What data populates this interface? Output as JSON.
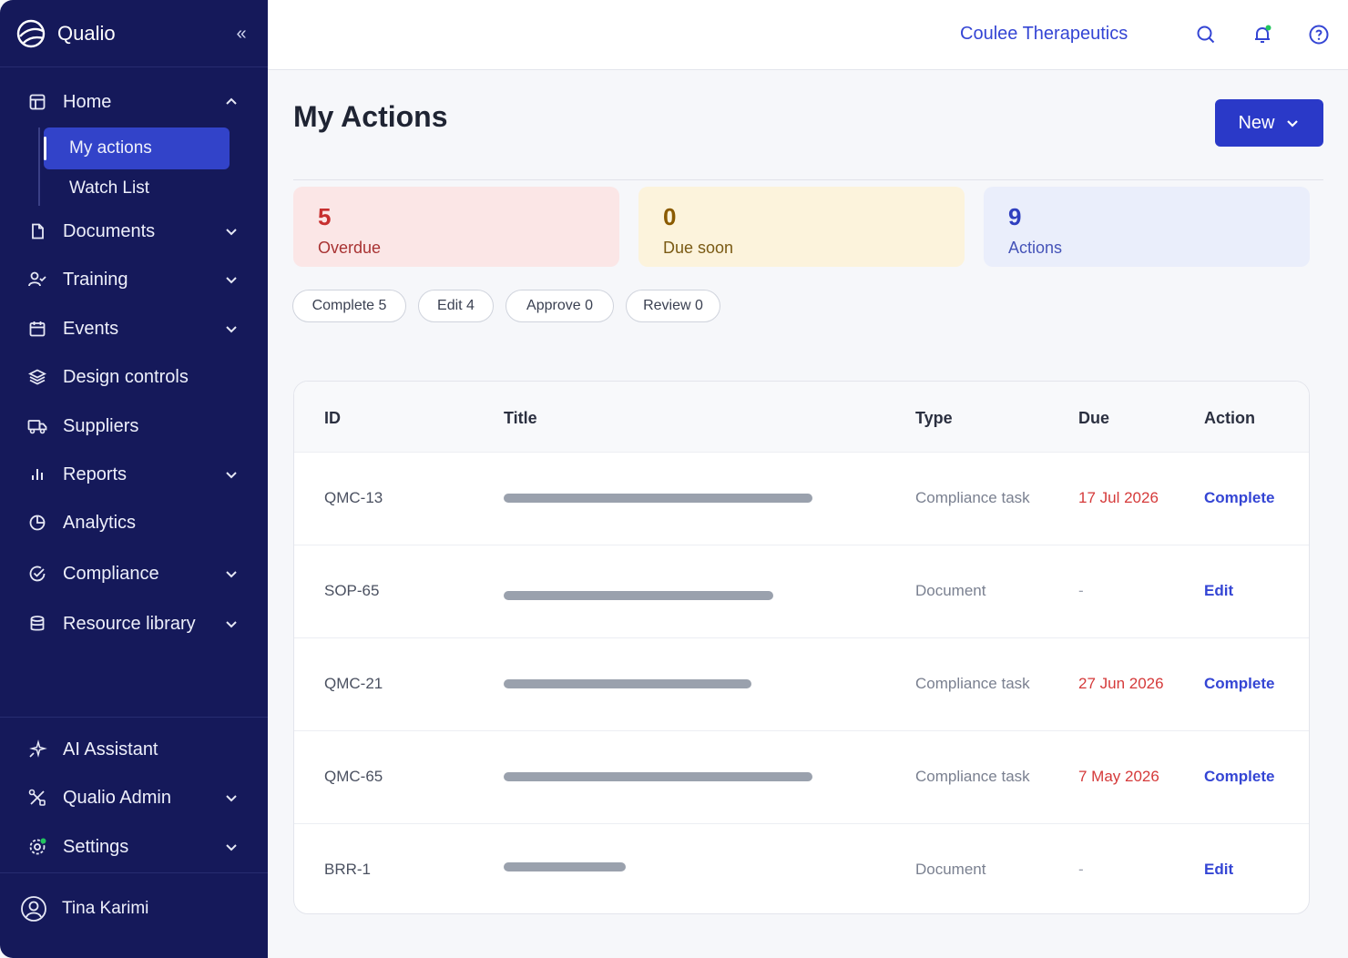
{
  "app": {
    "name": "Qualio"
  },
  "sidebar": {
    "items": [
      {
        "label": "Home",
        "icon": "layout-icon"
      },
      {
        "label": "Documents",
        "icon": "document-icon"
      },
      {
        "label": "Training",
        "icon": "user-check-icon"
      },
      {
        "label": "Events",
        "icon": "calendar-icon"
      },
      {
        "label": "Design controls",
        "icon": "layers-icon"
      },
      {
        "label": "Suppliers",
        "icon": "truck-icon"
      },
      {
        "label": "Reports",
        "icon": "bar-chart-icon"
      },
      {
        "label": "Analytics",
        "icon": "pie-chart-icon"
      },
      {
        "label": "Compliance",
        "icon": "check-circle-icon"
      },
      {
        "label": "Resource library",
        "icon": "database-icon"
      }
    ],
    "home_sub": [
      {
        "label": "My actions",
        "active": true
      },
      {
        "label": "Watch List",
        "active": false
      }
    ],
    "bottom_items": [
      {
        "label": "AI Assistant",
        "icon": "sparkle-icon"
      },
      {
        "label": "Qualio Admin",
        "icon": "tools-icon"
      },
      {
        "label": "Settings",
        "icon": "gear-icon"
      }
    ],
    "user": {
      "name": "Tina Karimi"
    }
  },
  "topbar": {
    "org_name": "Coulee Therapeutics"
  },
  "page": {
    "title": "My Actions",
    "new_button": "New"
  },
  "stats": [
    {
      "value": "5",
      "label": "Overdue",
      "bg": "#fbe6e6",
      "color": "#c72f2f",
      "label_color": "#a83232"
    },
    {
      "value": "0",
      "label": "Due soon",
      "bg": "#fcf3dc",
      "color": "#8a5a00",
      "label_color": "#7a5a14"
    },
    {
      "value": "9",
      "label": "Actions",
      "bg": "#eaeefb",
      "color": "#2f3fbf",
      "label_color": "#4553b8"
    }
  ],
  "filters": [
    "Complete 5",
    "Edit 4",
    "Approve 0",
    "Review 0"
  ],
  "table": {
    "headers": {
      "id": "ID",
      "title": "Title",
      "type": "Type",
      "due": "Due",
      "action": "Action"
    },
    "rows": [
      {
        "id": "QMC-13",
        "title_fill": 0.86,
        "type": "Compliance task",
        "due": "17 Jul 2026",
        "action": "Complete"
      },
      {
        "id": "SOP-65",
        "title_fill": 0.75,
        "type": "Document",
        "due": "-",
        "action": "Edit"
      },
      {
        "id": "QMC-21",
        "title_fill": 0.69,
        "type": "Compliance task",
        "due": "27 Jun 2026",
        "action": "Complete"
      },
      {
        "id": "QMC-65",
        "title_fill": 0.86,
        "type": "Compliance task",
        "due": "7 May 2026",
        "action": "Complete"
      },
      {
        "id": "BRR-1",
        "title_fill": 0.34,
        "type": "Document",
        "due": "-",
        "action": "Edit"
      }
    ]
  },
  "colors": {
    "sidebar_bg": "#15195a",
    "accent": "#2a39c8",
    "link": "#3445d4",
    "overdue": "#d53a3a"
  }
}
